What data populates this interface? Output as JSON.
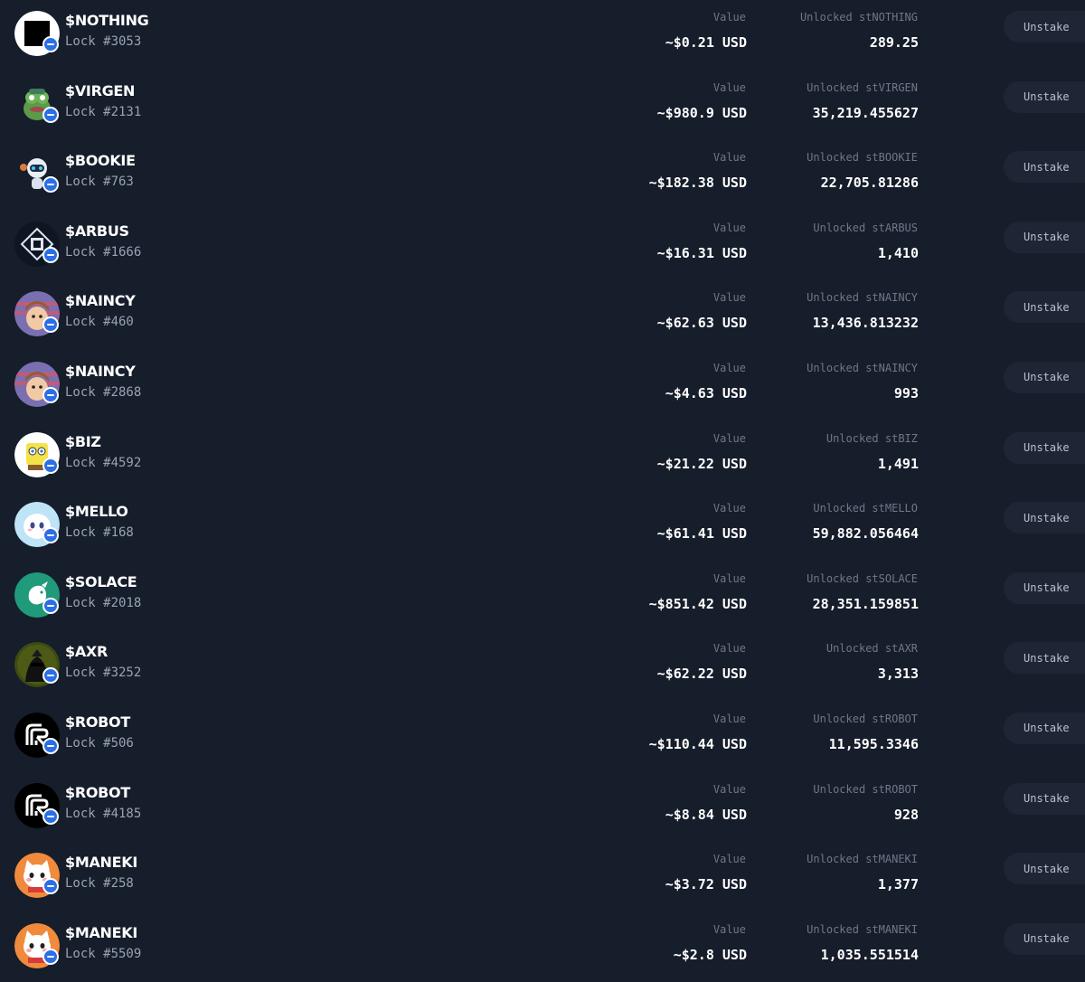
{
  "labels": {
    "value_label": "Value",
    "unstake_label": "Unstake"
  },
  "locks": [
    {
      "token": "$NOTHING",
      "lock": "Lock #3053",
      "value": "~$0.21 USD",
      "unlocked_label": "Unlocked stNOTHING",
      "unlocked": "289.25",
      "avatar": "black-square-icon"
    },
    {
      "token": "$VIRGEN",
      "lock": "Lock #2131",
      "value": "~$980.9 USD",
      "unlocked_label": "Unlocked stVIRGEN",
      "unlocked": "35,219.455627",
      "avatar": "frog-icon"
    },
    {
      "token": "$BOOKIE",
      "lock": "Lock #763",
      "value": "~$182.38 USD",
      "unlocked_label": "Unlocked stBOOKIE",
      "unlocked": "22,705.81286",
      "avatar": "robot-icon"
    },
    {
      "token": "$ARBUS",
      "lock": "Lock #1666",
      "value": "~$16.31 USD",
      "unlocked_label": "Unlocked stARBUS",
      "unlocked": "1,410",
      "avatar": "cube-icon"
    },
    {
      "token": "$NAINCY",
      "lock": "Lock #460",
      "value": "~$62.63 USD",
      "unlocked_label": "Unlocked stNAINCY",
      "unlocked": "13,436.813232",
      "avatar": "cartoon-face-icon"
    },
    {
      "token": "$NAINCY",
      "lock": "Lock #2868",
      "value": "~$4.63 USD",
      "unlocked_label": "Unlocked stNAINCY",
      "unlocked": "993",
      "avatar": "cartoon-face-icon"
    },
    {
      "token": "$BIZ",
      "lock": "Lock #4592",
      "value": "~$21.22 USD",
      "unlocked_label": "Unlocked stBIZ",
      "unlocked": "1,491",
      "avatar": "sponge-icon"
    },
    {
      "token": "$MELLO",
      "lock": "Lock #168",
      "value": "~$61.41 USD",
      "unlocked_label": "Unlocked stMELLO",
      "unlocked": "59,882.056464",
      "avatar": "ghost-icon"
    },
    {
      "token": "$SOLACE",
      "lock": "Lock #2018",
      "value": "~$851.42 USD",
      "unlocked_label": "Unlocked stSOLACE",
      "unlocked": "28,351.159851",
      "avatar": "bird-icon"
    },
    {
      "token": "$AXR",
      "lock": "Lock #3252",
      "value": "~$62.22 USD",
      "unlocked_label": "Unlocked stAXR",
      "unlocked": "3,313",
      "avatar": "hooded-figure-icon"
    },
    {
      "token": "$ROBOT",
      "lock": "Lock #506",
      "value": "~$110.44 USD",
      "unlocked_label": "Unlocked stROBOT",
      "unlocked": "11,595.3346",
      "avatar": "robot-logo-icon"
    },
    {
      "token": "$ROBOT",
      "lock": "Lock #4185",
      "value": "~$8.84 USD",
      "unlocked_label": "Unlocked stROBOT",
      "unlocked": "928",
      "avatar": "robot-logo-icon"
    },
    {
      "token": "$MANEKI",
      "lock": "Lock #258",
      "value": "~$3.72 USD",
      "unlocked_label": "Unlocked stMANEKI",
      "unlocked": "1,377",
      "avatar": "cat-icon"
    },
    {
      "token": "$MANEKI",
      "lock": "Lock #5509",
      "value": "~$2.8 USD",
      "unlocked_label": "Unlocked stMANEKI",
      "unlocked": "1,035.551514",
      "avatar": "cat-icon"
    }
  ]
}
